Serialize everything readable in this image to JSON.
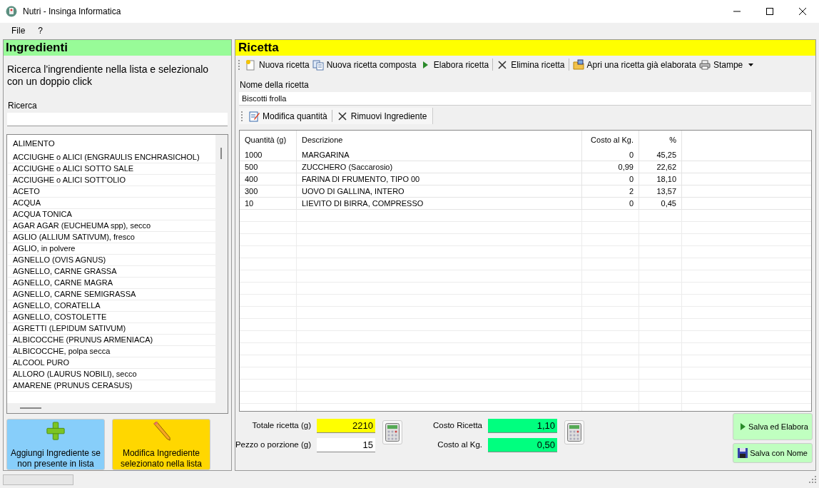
{
  "window": {
    "title": "Nutri -  Insinga Informatica"
  },
  "menu": [
    "File",
    "?"
  ],
  "ingredients": {
    "title": "Ingredienti",
    "instructions": "Ricerca l'ingrendiente nella lista e selezionalo con un doppio click",
    "search_label": "Ricerca",
    "list_header": "ALIMENTO",
    "items": [
      "ACCIUGHE o ALICI (ENGRAULIS ENCHRASICHOL)",
      "ACCIUGHE o ALICI SOTTO SALE",
      "ACCIUGHE o ALICI SOTT'OLIO",
      "ACETO",
      "ACQUA",
      "ACQUA TONICA",
      "AGAR AGAR (EUCHEUMA spp), secco",
      "AGLIO (ALLIUM SATIVUM), fresco",
      "AGLIO, in polvere",
      "AGNELLO (OVIS AGNUS)",
      "AGNELLO, CARNE GRASSA",
      "AGNELLO, CARNE MAGRA",
      "AGNELLO, CARNE SEMIGRASSA",
      "AGNELLO, CORATELLA",
      "AGNELLO, COSTOLETTE",
      "AGRETTI (LEPIDUM SATIVUM)",
      "ALBICOCCHE (PRUNUS ARMENIACA)",
      "ALBICOCCHE, polpa secca",
      "ALCOOL PURO",
      "ALLORO (LAURUS NOBILI), secco",
      "AMARENE (PRUNUS CERASUS)"
    ],
    "buttons": [
      {
        "kind": "add",
        "label": "Aggiungi Ingrediente se non presente in lista"
      },
      {
        "kind": "edit",
        "label": "Modifica Ingrediente selezionato nella lista"
      }
    ]
  },
  "recipe": {
    "title": "Ricetta",
    "toolbar": [
      {
        "kind": "new",
        "label": "Nuova ricetta"
      },
      {
        "kind": "copy",
        "label": "Nuova ricetta composta"
      },
      {
        "kind": "play",
        "label": "Elabora ricetta"
      },
      {
        "kind": "delete",
        "label": "Elimina ricetta"
      },
      {
        "kind": "folder",
        "label": "Apri una ricetta già elaborata"
      },
      {
        "kind": "print",
        "label": "Stampe"
      }
    ],
    "name_label": "Nome della ricetta",
    "name_value": "Biscotti frolla",
    "grid_toolbar": [
      {
        "kind": "edit",
        "label": "Modifica quantità"
      },
      {
        "kind": "delete",
        "label": "Rimuovi Ingrediente"
      }
    ],
    "table": {
      "columns": [
        "Quantità (g)",
        "Descrizione",
        "Costo al Kg.",
        "%"
      ],
      "rows": [
        [
          "1000",
          "MARGARINA",
          "0",
          "45,25"
        ],
        [
          "500",
          "ZUCCHERO (Saccarosio)",
          "0,99",
          "22,62"
        ],
        [
          "400",
          "FARINA DI FRUMENTO, TIPO 00",
          "0",
          "18,10"
        ],
        [
          "300",
          "UOVO DI GALLINA, INTERO",
          "2",
          "13,57"
        ],
        [
          "10",
          "LIEVITO DI BIRRA, COMPRESSO",
          "0",
          "0,45"
        ]
      ]
    },
    "fields": [
      {
        "label": "Totale ricetta (g)",
        "value": "2210",
        "color": "#ffff00"
      },
      {
        "label": "Costo Ricetta",
        "value": "1,10",
        "color": "#00ff7f"
      },
      {
        "label": "Pezzo o porzione (g)",
        "value": "15",
        "color": "#ffffff"
      },
      {
        "label": "Costo al Kg.",
        "value": "0,50",
        "color": "#00ff7f"
      }
    ],
    "buttons": [
      {
        "kind": "play",
        "label": "Salva ed Elabora"
      },
      {
        "kind": "save",
        "label": "Salva con Nome"
      }
    ]
  },
  "status_bar": {
    "progress": {
      "level": 0
    }
  }
}
